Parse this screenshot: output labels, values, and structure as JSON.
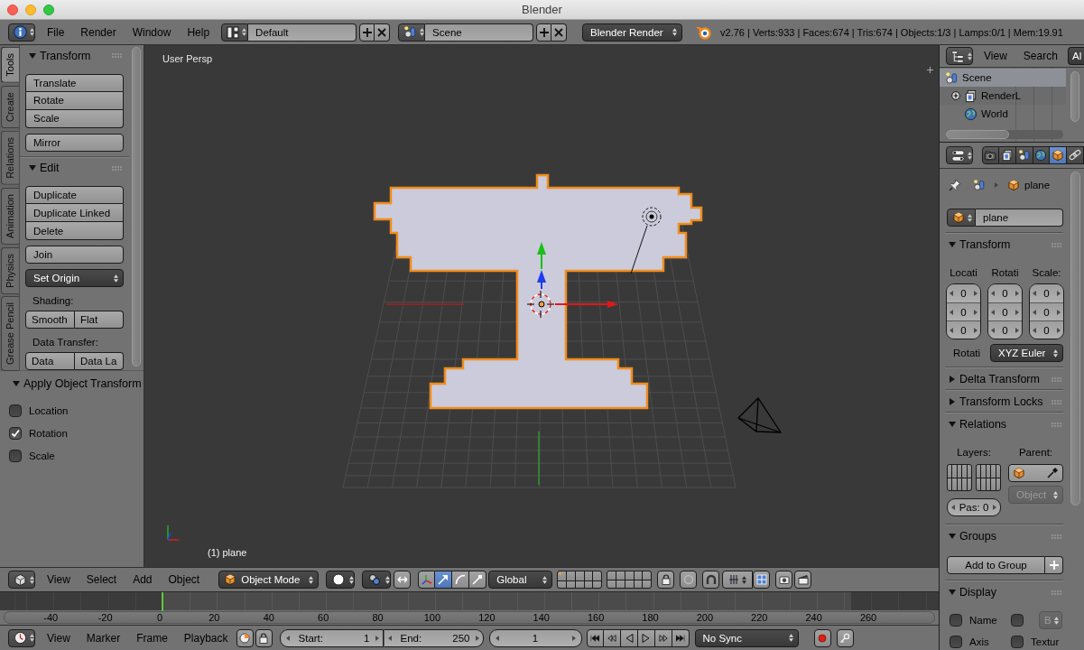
{
  "window": {
    "title": "Blender"
  },
  "info_header": {
    "menus": [
      "File",
      "Render",
      "Window",
      "Help"
    ],
    "screen_layout": "Default",
    "scene": "Scene",
    "render_engine": "Blender Render",
    "stats": "v2.76 | Verts:933 | Faces:674 | Tris:674 | Objects:1/3 | Lamps:0/1 | Mem:19.91"
  },
  "tool_shelf": {
    "tabs": [
      {
        "label": "Tools",
        "selected": true
      },
      {
        "label": "Create",
        "selected": false
      },
      {
        "label": "Relations",
        "selected": false
      },
      {
        "label": "Animation",
        "selected": false
      },
      {
        "label": "Physics",
        "selected": false
      },
      {
        "label": "Grease Pencil",
        "selected": false
      }
    ],
    "panels": [
      {
        "title": "Transform",
        "expanded": true,
        "items": [
          {
            "kind": "column",
            "buttons": [
              "Translate",
              "Rotate",
              "Scale"
            ]
          },
          {
            "kind": "column",
            "buttons": [
              "Mirror"
            ]
          }
        ]
      },
      {
        "title": "Edit",
        "expanded": true,
        "items": [
          {
            "kind": "column",
            "buttons": [
              "Duplicate",
              "Duplicate Linked",
              "Delete"
            ]
          },
          {
            "kind": "column",
            "buttons": [
              "Join"
            ]
          },
          {
            "kind": "dropdown",
            "value": "Set Origin"
          },
          {
            "kind": "label",
            "text": "Shading:"
          },
          {
            "kind": "row",
            "buttons": [
              "Smooth",
              "Flat"
            ]
          },
          {
            "kind": "label",
            "text": "Data Transfer:"
          },
          {
            "kind": "row",
            "buttons": [
              "Data",
              "Data La"
            ]
          }
        ]
      }
    ]
  },
  "operator_panel": {
    "title": "Apply Object Transform",
    "expanded": true,
    "options": [
      {
        "label": "Location",
        "checked": false
      },
      {
        "label": "Rotation",
        "checked": true
      },
      {
        "label": "Scale",
        "checked": false
      }
    ]
  },
  "viewport": {
    "view_name": "User Persp",
    "object_label": "(1) plane"
  },
  "viewport_header": {
    "menus": [
      "View",
      "Select",
      "Add",
      "Object"
    ],
    "mode": "Object Mode",
    "manipulators": [
      {
        "selected": false
      },
      {
        "selected": true
      },
      {
        "selected": false
      },
      {
        "selected": false
      }
    ],
    "orientation": "Global",
    "layers": [
      {
        "used": true
      },
      {
        "used": false
      },
      {
        "used": false
      },
      {
        "used": false
      },
      {
        "used": false
      },
      {
        "used": false
      },
      {
        "used": false
      },
      {
        "used": false
      },
      {
        "used": false
      },
      {
        "used": false
      },
      {
        "used": false
      },
      {
        "used": false
      },
      {
        "used": false
      },
      {
        "used": false
      },
      {
        "used": false
      },
      {
        "used": false
      },
      {
        "used": false
      },
      {
        "used": false
      },
      {
        "used": false
      },
      {
        "used": false
      }
    ]
  },
  "timeline": {
    "ruler_labels": [
      "-40",
      "-20",
      "0",
      "20",
      "40",
      "60",
      "80",
      "100",
      "120",
      "140",
      "160",
      "180",
      "200",
      "220",
      "240",
      "260"
    ]
  },
  "timeline_header": {
    "menus": [
      "View",
      "Marker",
      "Frame",
      "Playback"
    ],
    "start_label": "Start:",
    "start": "1",
    "end_label": "End:",
    "end": "250",
    "current_frame": "1",
    "sync": "No Sync"
  },
  "outliner": {
    "menus": [
      "View",
      "Search"
    ],
    "display_mode": "Al",
    "tree": [
      {
        "label": "Scene",
        "selected": true,
        "children": [
          {
            "label": "RenderL",
            "selected": false,
            "expandable": true
          },
          {
            "label": "World",
            "selected": false,
            "expandable": false
          }
        ]
      }
    ]
  },
  "properties": {
    "tabs": [
      {
        "selected": false
      },
      {
        "selected": false
      },
      {
        "selected": false
      },
      {
        "selected": false
      },
      {
        "selected": true
      },
      {
        "selected": false
      }
    ],
    "breadcrumb": "plane",
    "object_name": "plane",
    "panels": [
      {
        "kind": "transform",
        "title": "Transform",
        "expanded": true,
        "columns": [
          {
            "label": "Locati",
            "values": [
              "0",
              "0",
              "0"
            ]
          },
          {
            "label": "Rotati",
            "values": [
              "0",
              "0",
              "0"
            ]
          },
          {
            "label": "Scale:",
            "values": [
              "0",
              "0",
              "0"
            ]
          }
        ],
        "rotation_label": "Rotati",
        "rotation_mode": "XYZ Euler"
      },
      {
        "kind": "delta",
        "title": "Delta Transform",
        "expanded": false
      },
      {
        "kind": "locks",
        "title": "Transform Locks",
        "expanded": false
      },
      {
        "kind": "relations",
        "title": "Relations",
        "expanded": true,
        "layers_label": "Layers:",
        "parent_label": "Parent:",
        "parent_type": "Object",
        "parent_type_disabled": true,
        "pass_index": "Pas: 0"
      },
      {
        "kind": "groups",
        "title": "Groups",
        "expanded": true,
        "button": "Add to Group"
      },
      {
        "kind": "display",
        "title": "Display",
        "expanded": true,
        "options": [
          {
            "kind": "checkbox",
            "label": "Name",
            "checked": false
          },
          {
            "kind": "checkbox_dropdown",
            "checked": false,
            "value": "B",
            "dropdown_disabled": true
          },
          {
            "kind": "checkbox",
            "label": "Axis",
            "checked": false
          },
          {
            "kind": "checkbox",
            "label": "Textur",
            "checked": false
          }
        ]
      }
    ]
  }
}
